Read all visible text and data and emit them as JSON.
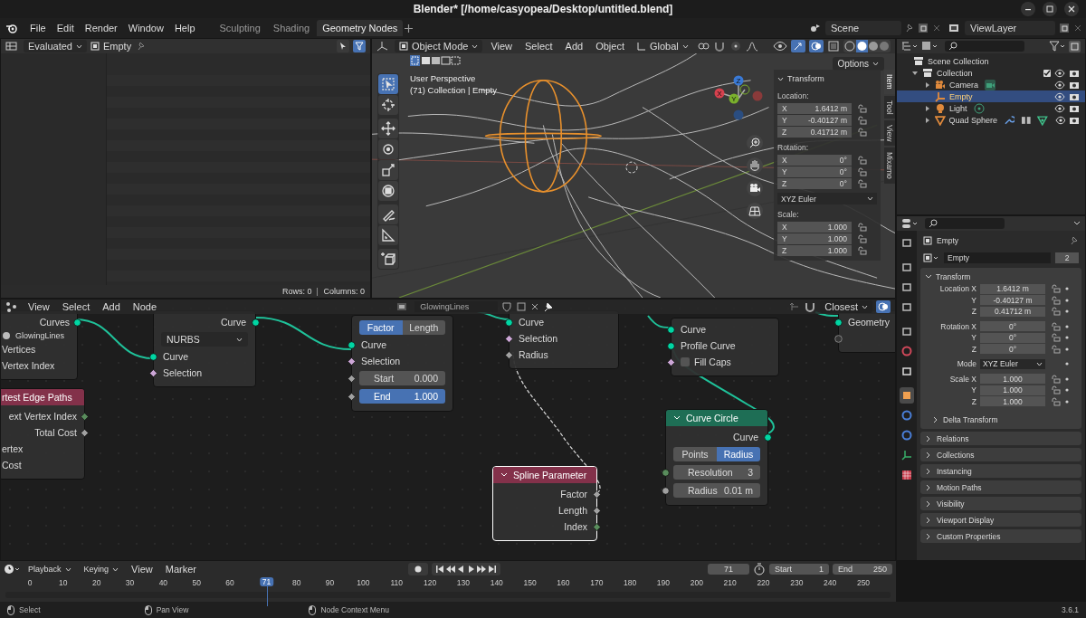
{
  "window": {
    "title": "Blender* [/home/casyopea/Desktop/untitled.blend]"
  },
  "menu": [
    "File",
    "Edit",
    "Render",
    "Window",
    "Help"
  ],
  "workspaces": [
    {
      "label": "Sculpting",
      "selected": false
    },
    {
      "label": "Shading",
      "selected": false
    },
    {
      "label": "Geometry Nodes",
      "selected": true
    }
  ],
  "scene": "Scene",
  "view_layer": "ViewLayer",
  "spreadsheet": {
    "evaluation": "Evaluated",
    "object": "Empty",
    "rows": "Rows: 0",
    "columns": "Columns: 0"
  },
  "viewport": {
    "mode": "Object Mode",
    "menu": [
      "View",
      "Select",
      "Add",
      "Object"
    ],
    "orientation": "Global",
    "options": "Options",
    "info": [
      "User Perspective",
      "(71) Collection | Empty"
    ],
    "tools": [
      {
        "kind": "select",
        "selected": true
      },
      {
        "kind": "cursor",
        "selected": false
      },
      {
        "kind": "move",
        "selected": false
      },
      {
        "kind": "rotate",
        "selected": false
      },
      {
        "kind": "scale",
        "selected": false
      },
      {
        "kind": "transform",
        "selected": false
      },
      {
        "kind": "annotate",
        "selected": false
      },
      {
        "kind": "measure",
        "selected": false
      },
      {
        "kind": "add-cube",
        "selected": false
      }
    ],
    "gizmo": [
      {
        "axis": "Z",
        "color": "#3a7ad6"
      },
      {
        "axis": "X",
        "color": "#d6414e"
      },
      {
        "axis": "Y",
        "color": "#7ab02c"
      }
    ],
    "panel": {
      "title": "Transform",
      "groups": [
        {
          "label": "Location:",
          "fields": [
            {
              "axis": "X",
              "value": "1.6412 m"
            },
            {
              "axis": "Y",
              "value": "-0.40127 m"
            },
            {
              "axis": "Z",
              "value": "0.41712 m"
            }
          ]
        },
        {
          "label": "Rotation:",
          "fields": [
            {
              "axis": "X",
              "value": "0°"
            },
            {
              "axis": "Y",
              "value": "0°"
            },
            {
              "axis": "Z",
              "value": "0°"
            }
          ],
          "mode": "XYZ Euler"
        },
        {
          "label": "Scale:",
          "fields": [
            {
              "axis": "X",
              "value": "1.000"
            },
            {
              "axis": "Y",
              "value": "1.000"
            },
            {
              "axis": "Z",
              "value": "1.000"
            }
          ]
        }
      ]
    },
    "side_tabs": [
      {
        "label": "Item",
        "selected": true
      },
      {
        "label": "Tool",
        "selected": false
      },
      {
        "label": "View",
        "selected": false
      },
      {
        "label": "Mixamo",
        "selected": false
      }
    ]
  },
  "outliner": {
    "root": "Scene Collection",
    "items": [
      {
        "name": "Collection",
        "kind": "collection",
        "expanded": true,
        "checked": true,
        "selected": false,
        "children": [
          {
            "name": "Camera",
            "kind": "camera",
            "expanded": false,
            "selected": false,
            "badges": [
              {
                "kind": "camera-data"
              }
            ]
          },
          {
            "name": "Empty",
            "kind": "empty",
            "selected": true
          },
          {
            "name": "Light",
            "kind": "light",
            "expanded": false,
            "selected": false,
            "badges": [
              {
                "kind": "light-data"
              }
            ]
          },
          {
            "name": "Quad Sphere",
            "kind": "mesh",
            "expanded": false,
            "selected": false,
            "badges": [
              {
                "kind": "wrench"
              },
              {
                "kind": "modifier"
              },
              {
                "kind": "mesh-data"
              }
            ]
          }
        ]
      }
    ]
  },
  "properties": {
    "tabs": [
      {
        "kind": "tool",
        "selected": false
      },
      {
        "kind": "render",
        "selected": false
      },
      {
        "kind": "output",
        "selected": false
      },
      {
        "kind": "view-layer",
        "selected": false
      },
      {
        "kind": "scene",
        "selected": false
      },
      {
        "kind": "world",
        "selected": false
      },
      {
        "kind": "collection",
        "selected": false
      },
      {
        "kind": "object",
        "selected": true
      },
      {
        "kind": "physics",
        "selected": false
      },
      {
        "kind": "constraints",
        "selected": false
      },
      {
        "kind": "data",
        "selected": false
      },
      {
        "kind": "texture",
        "selected": false
      }
    ],
    "object": "Empty",
    "data_name": "Empty",
    "users": "2",
    "transform": {
      "title": "Transform",
      "expanded": true,
      "rows": [
        {
          "label": "Location X",
          "value": "1.6412 m",
          "kind": "number"
        },
        {
          "label": "Y",
          "value": "-0.40127 m",
          "kind": "number"
        },
        {
          "label": "Z",
          "value": "0.41712 m",
          "kind": "number"
        },
        {
          "label": "Rotation X",
          "value": "0°",
          "kind": "number"
        },
        {
          "label": "Y",
          "value": "0°",
          "kind": "number"
        },
        {
          "label": "Z",
          "value": "0°",
          "kind": "number"
        },
        {
          "label": "Mode",
          "value": "XYZ Euler",
          "kind": "dropdown"
        },
        {
          "label": "Scale X",
          "value": "1.000",
          "kind": "number"
        },
        {
          "label": "Y",
          "value": "1.000",
          "kind": "number"
        },
        {
          "label": "Z",
          "value": "1.000",
          "kind": "number"
        }
      ],
      "subpanel": "Delta Transform"
    },
    "panels": [
      "Relations",
      "Collections",
      "Instancing",
      "Motion Paths",
      "Visibility",
      "Viewport Display",
      "Custom Properties"
    ]
  },
  "node_editor": {
    "menu": [
      "View",
      "Select",
      "Add",
      "Node"
    ],
    "tree": "GlowingLines",
    "snap": "Closest",
    "nodes": [
      {
        "selected": false,
        "rows": [
          {
            "kind": "output",
            "label": "Curves",
            "socket": {
              "kind": "geometry"
            }
          },
          {
            "kind": "object",
            "label": "GlowingLines"
          },
          {
            "kind": "input",
            "label": "Vertices"
          },
          {
            "kind": "input",
            "label": "Vertex Index"
          }
        ]
      },
      {
        "selected": false,
        "header": {
          "title": "rtest Edge Paths",
          "color": "#83314a"
        },
        "rows": [
          {
            "kind": "output",
            "label": "ext Vertex Index",
            "socket": {
              "kind": "int_field"
            }
          },
          {
            "kind": "output",
            "label": "Total Cost",
            "socket": {
              "kind": "float_field"
            }
          },
          {
            "kind": "input",
            "label": "ertex"
          },
          {
            "kind": "input",
            "label": "Cost"
          }
        ]
      },
      {
        "selected": false,
        "rows": [
          {
            "kind": "output",
            "label": "Curve",
            "socket": {
              "kind": "geometry"
            }
          },
          {
            "kind": "dropdown",
            "label": "NURBS"
          },
          {
            "kind": "input",
            "label": "Curve",
            "socket": {
              "kind": "geometry"
            }
          },
          {
            "kind": "input",
            "label": "Selection",
            "socket": {
              "kind": "bool_field"
            }
          }
        ]
      },
      {
        "selected": false,
        "rows": [
          {
            "kind": "toggle",
            "options": [
              {
                "label": "Factor",
                "selected": true
              },
              {
                "label": "Length",
                "selected": false
              }
            ]
          },
          {
            "kind": "input",
            "label": "Curve",
            "socket": {
              "kind": "geometry"
            }
          },
          {
            "kind": "input",
            "label": "Selection",
            "socket": {
              "kind": "bool_field"
            }
          },
          {
            "kind": "field",
            "label": "Start",
            "value": "0.000",
            "socket": {
              "kind": "float_field"
            },
            "active": false
          },
          {
            "kind": "field",
            "label": "End",
            "value": "1.000",
            "socket": {
              "kind": "float_field"
            },
            "active": true
          }
        ]
      },
      {
        "selected": false,
        "rows": [
          {
            "kind": "input",
            "label": "Curve",
            "socket": {
              "kind": "geometry"
            }
          },
          {
            "kind": "input",
            "label": "Selection",
            "socket": {
              "kind": "bool_field"
            }
          },
          {
            "kind": "input",
            "label": "Radius",
            "socket": {
              "kind": "float_field"
            }
          }
        ]
      },
      {
        "selected": false,
        "rows": [
          {
            "kind": "input",
            "label": "Curve",
            "socket": {
              "kind": "geometry"
            }
          },
          {
            "kind": "input",
            "label": "Profile Curve",
            "socket": {
              "kind": "geometry"
            }
          },
          {
            "kind": "checkbox",
            "label": "Fill Caps",
            "socket": {
              "kind": "bool_field"
            },
            "checked": false
          }
        ]
      },
      {
        "selected": false,
        "rows": [
          {
            "kind": "input",
            "label": "Geometry",
            "socket": {
              "kind": "geometry"
            }
          },
          {
            "kind": "socket_only",
            "socket": {
              "kind": "unused"
            }
          }
        ]
      },
      {
        "selected": false,
        "header": {
          "title": "Curve Circle",
          "color": "#1e6e55",
          "expanded": true
        },
        "rows": [
          {
            "kind": "output",
            "label": "Curve",
            "socket": {
              "kind": "geometry"
            }
          },
          {
            "kind": "toggle",
            "options": [
              {
                "label": "Points",
                "selected": false
              },
              {
                "label": "Radius",
                "selected": true
              }
            ]
          },
          {
            "kind": "field",
            "label": "Resolution",
            "value": "3",
            "socket": {
              "kind": "int"
            },
            "active": false
          },
          {
            "kind": "field",
            "label": "Radius",
            "value": "0.01 m",
            "socket": {
              "kind": "float"
            },
            "active": false
          }
        ]
      },
      {
        "selected": true,
        "header": {
          "title": "Spline Parameter",
          "color": "#83314a",
          "expanded": true
        },
        "rows": [
          {
            "kind": "output",
            "label": "Factor",
            "socket": {
              "kind": "float_field"
            }
          },
          {
            "kind": "output",
            "label": "Length",
            "socket": {
              "kind": "float_field"
            }
          },
          {
            "kind": "output",
            "label": "Index",
            "socket": {
              "kind": "int_field"
            }
          }
        ]
      }
    ]
  },
  "timeline": {
    "menu": [
      "Playback",
      "Keying",
      "View",
      "Marker"
    ],
    "current": "71",
    "start_label": "Start",
    "start": "1",
    "end_label": "End",
    "end": "250",
    "ticks": [
      "0",
      "10",
      "20",
      "30",
      "40",
      "50",
      "60",
      "80",
      "90",
      "100",
      "110",
      "120",
      "130",
      "140",
      "150",
      "160",
      "170",
      "180",
      "190",
      "200",
      "210",
      "220",
      "230",
      "240",
      "250"
    ],
    "playhead": {
      "label": "71",
      "level": 0.284
    }
  },
  "status_bar": {
    "hints": [
      "Select",
      "Pan View",
      "Node Context Menu"
    ],
    "version": "3.6.1"
  }
}
